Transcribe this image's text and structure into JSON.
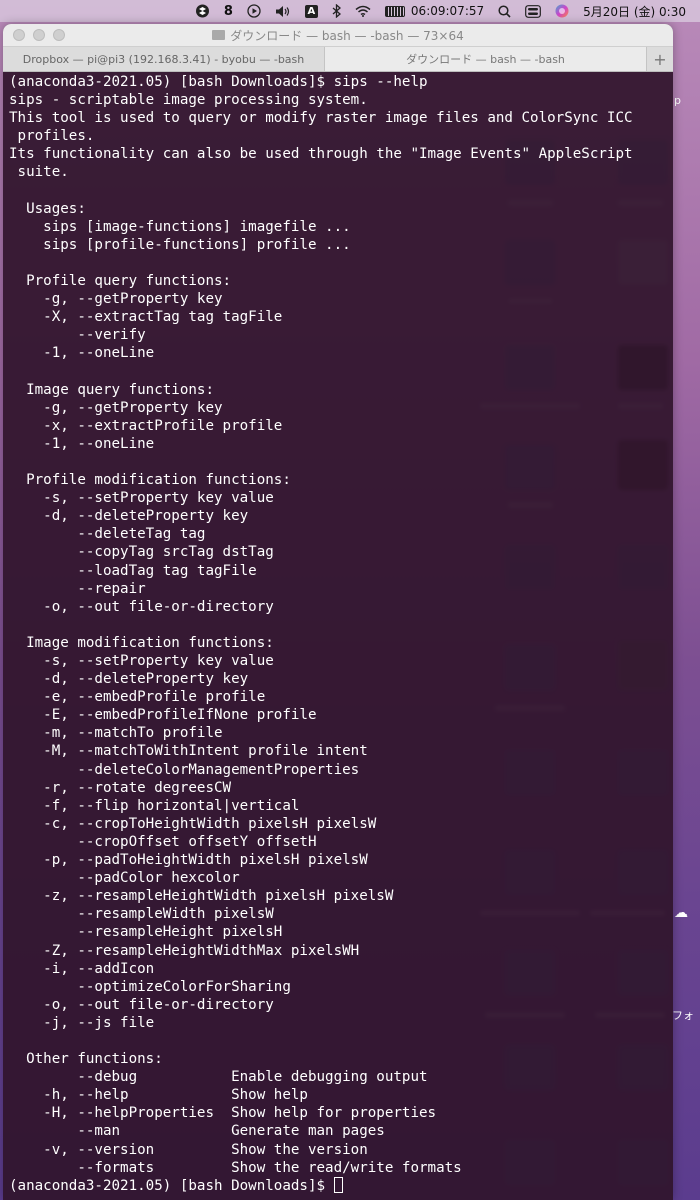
{
  "menubar": {
    "input_badge": "A",
    "battery_text": "06:09:07:57",
    "datetime": "5月20日 (金)  0:30"
  },
  "window": {
    "title": "ダウンロード — bash — -bash — 73×64",
    "tabs": [
      {
        "label": "Dropbox — pi@pi3 (192.168.3.41) - byobu — -bash",
        "active": false
      },
      {
        "label": "ダウンロード — bash — -bash",
        "active": true
      }
    ],
    "add_tab": "+"
  },
  "terminal": {
    "lines": [
      "(anaconda3-2021.05) [bash Downloads]$ sips --help",
      "sips - scriptable image processing system.",
      "This tool is used to query or modify raster image files and ColorSync ICC",
      " profiles.",
      "Its functionality can also be used through the \"Image Events\" AppleScript",
      " suite.",
      "",
      "  Usages:",
      "    sips [image-functions] imagefile ...",
      "    sips [profile-functions] profile ...",
      "",
      "  Profile query functions:",
      "    -g, --getProperty key",
      "    -X, --extractTag tag tagFile",
      "        --verify",
      "    -1, --oneLine",
      "",
      "  Image query functions:",
      "    -g, --getProperty key",
      "    -x, --extractProfile profile",
      "    -1, --oneLine",
      "",
      "  Profile modification functions:",
      "    -s, --setProperty key value",
      "    -d, --deleteProperty key",
      "        --deleteTag tag",
      "        --copyTag srcTag dstTag",
      "        --loadTag tag tagFile",
      "        --repair",
      "    -o, --out file-or-directory",
      "",
      "  Image modification functions:",
      "    -s, --setProperty key value",
      "    -d, --deleteProperty key",
      "    -e, --embedProfile profile",
      "    -E, --embedProfileIfNone profile",
      "    -m, --matchTo profile",
      "    -M, --matchToWithIntent profile intent",
      "        --deleteColorManagementProperties",
      "    -r, --rotate degreesCW",
      "    -f, --flip horizontal|vertical",
      "    -c, --cropToHeightWidth pixelsH pixelsW",
      "        --cropOffset offsetY offsetH",
      "    -p, --padToHeightWidth pixelsH pixelsW",
      "        --padColor hexcolor",
      "    -z, --resampleHeightWidth pixelsH pixelsW",
      "        --resampleWidth pixelsW",
      "        --resampleHeight pixelsH",
      "    -Z, --resampleHeightWidthMax pixelsWH",
      "    -i, --addIcon",
      "        --optimizeColorForSharing",
      "    -o, --out file-or-directory",
      "    -j, --js file",
      "",
      "  Other functions:",
      "        --debug           Enable debugging output",
      "    -h, --help            Show help",
      "    -H, --helpProperties  Show help for properties",
      "        --man             Generate man pages",
      "    -v, --version         Show the version",
      "        --formats         Show the read/write formats"
    ],
    "prompt": "(anaconda3-2021.05) [bash Downloads]$ "
  },
  "desktop": {
    "edge_texts": [
      "p",
      "フォ"
    ]
  },
  "colors": {
    "terminal_bg": "#30142c",
    "terminal_fg": "#ffffff"
  }
}
